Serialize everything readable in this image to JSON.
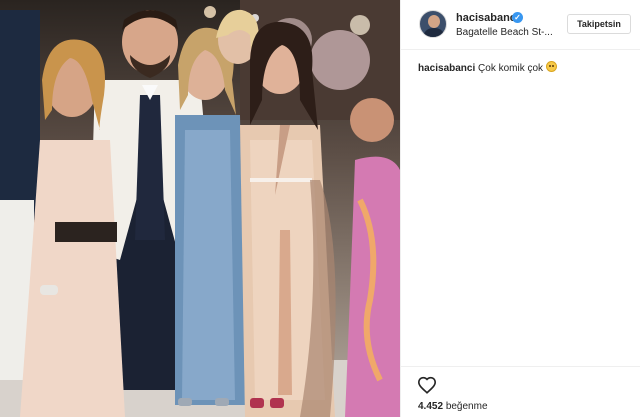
{
  "post": {
    "photo_alt": "",
    "header": {
      "username": "hacisabanci",
      "verified_icon": "verified-badge-icon",
      "location": "Bagatelle Beach St-...",
      "follow_label": "Takipetsin"
    },
    "caption": {
      "username": "hacisabanci",
      "text": "Çok komik çok"
    },
    "likes": {
      "count": "4.452",
      "label": "beğenme"
    }
  },
  "colors": {
    "verified": "#3897f0",
    "border": "#efefef",
    "text": "#262626"
  }
}
